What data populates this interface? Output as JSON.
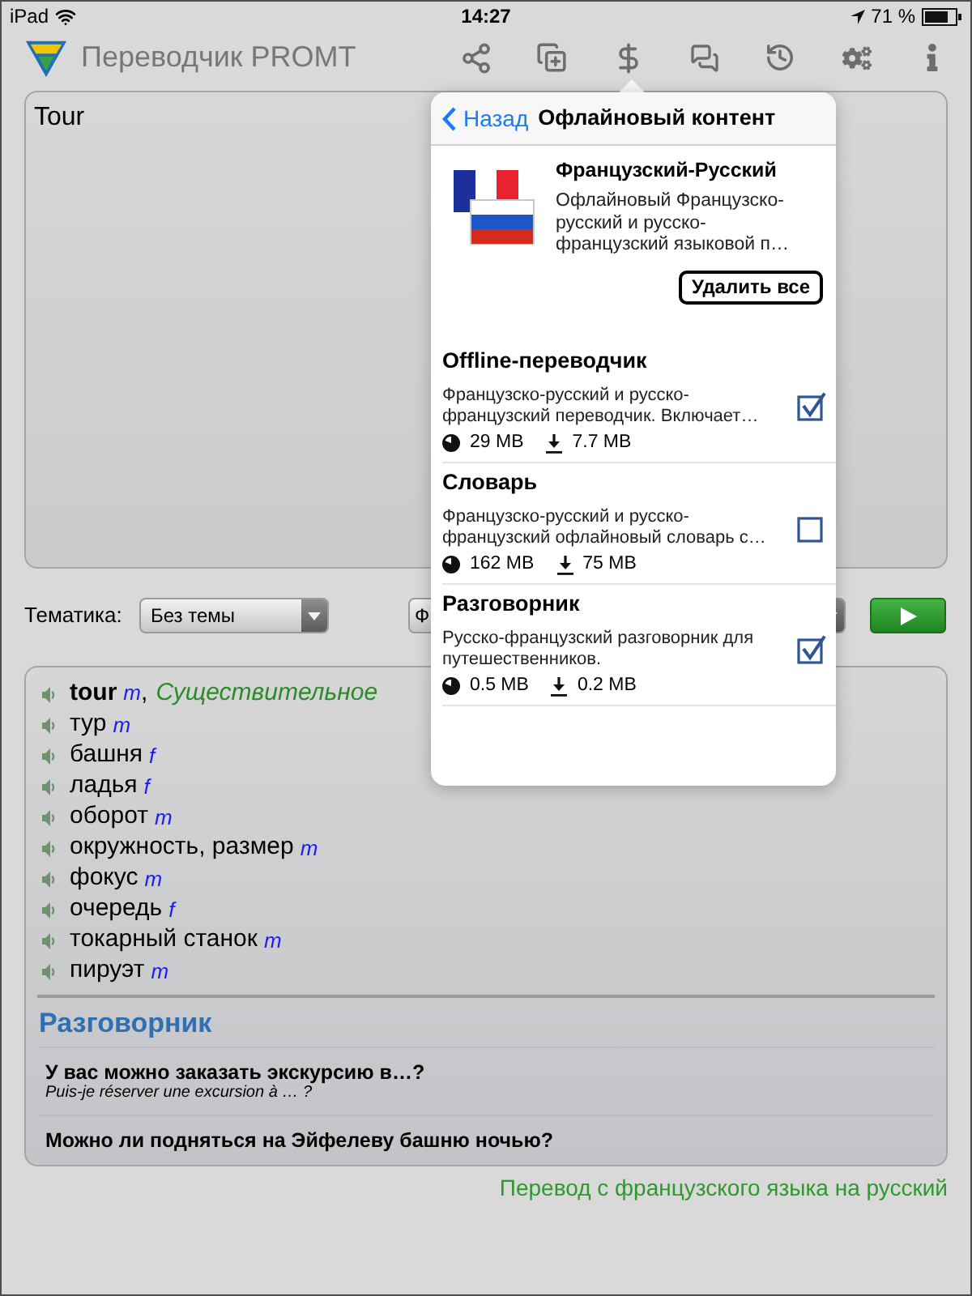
{
  "status_bar": {
    "device": "iPad",
    "time": "14:27",
    "battery": "71 %"
  },
  "toolbar": {
    "title": "Переводчик PROMT",
    "icons": [
      {
        "kind": "share"
      },
      {
        "kind": "add_document"
      },
      {
        "kind": "dollar"
      },
      {
        "kind": "chat"
      },
      {
        "kind": "history"
      },
      {
        "kind": "settings"
      },
      {
        "kind": "info"
      }
    ]
  },
  "source_text": {
    "value": "Tour"
  },
  "options": {
    "topic_label": "Тематика:",
    "topic_select": {
      "value": "Без темы"
    },
    "direction_select": {
      "value": "Ф"
    }
  },
  "results": {
    "entries": [
      {
        "kind": "headword",
        "word": "tour",
        "gender": "m",
        "separator": ",",
        "part_of_speech": "Существительное"
      },
      {
        "kind": "translation",
        "word": "тур",
        "gender": "m"
      },
      {
        "kind": "translation",
        "word": "башня",
        "gender": "f"
      },
      {
        "kind": "translation",
        "word": "ладья",
        "gender": "f"
      },
      {
        "kind": "translation",
        "word": "оборот",
        "gender": "m"
      },
      {
        "kind": "translation",
        "word": "окружность, размер",
        "gender": "m"
      },
      {
        "kind": "translation",
        "word": "фокус",
        "gender": "m"
      },
      {
        "kind": "translation",
        "word": "очередь",
        "gender": "f"
      },
      {
        "kind": "translation",
        "word": "токарный станок",
        "gender": "m"
      },
      {
        "kind": "translation",
        "word": "пируэт",
        "gender": "m"
      }
    ],
    "phrasebook": {
      "title": "Разговорник",
      "phrases": [
        {
          "text": "У вас можно заказать экскурсию в…?",
          "translation": "Puis-je réserver une excursion à … ?"
        },
        {
          "text": "Можно ли подняться на Эйфелеву башню ночью?"
        }
      ]
    }
  },
  "direction_note": "Перевод с французского языка на русский",
  "popover": {
    "back_label": "Назад",
    "title": "Офлайновый контент",
    "package": {
      "name": "Французский-Русский",
      "description": "Офлайновый Французско-русский и русско-французский языковой п…",
      "delete_button": "Удалить все"
    },
    "components": [
      {
        "name": "Offline-переводчик",
        "description": "Французско-русский и русско-французский переводчик. Включает…",
        "checked": true,
        "installed_size": "29 MB",
        "download_size": "7.7 MB"
      },
      {
        "name": "Словарь",
        "description": "Французско-русский и русско-французский офлайновый словарь с…",
        "checked": false,
        "installed_size": "162 MB",
        "download_size": "75 MB"
      },
      {
        "name": "Разговорник",
        "description": "Русско-французский разговорник для путешественников.",
        "checked": true,
        "installed_size": "0.5 MB",
        "download_size": "0.2 MB"
      }
    ]
  }
}
